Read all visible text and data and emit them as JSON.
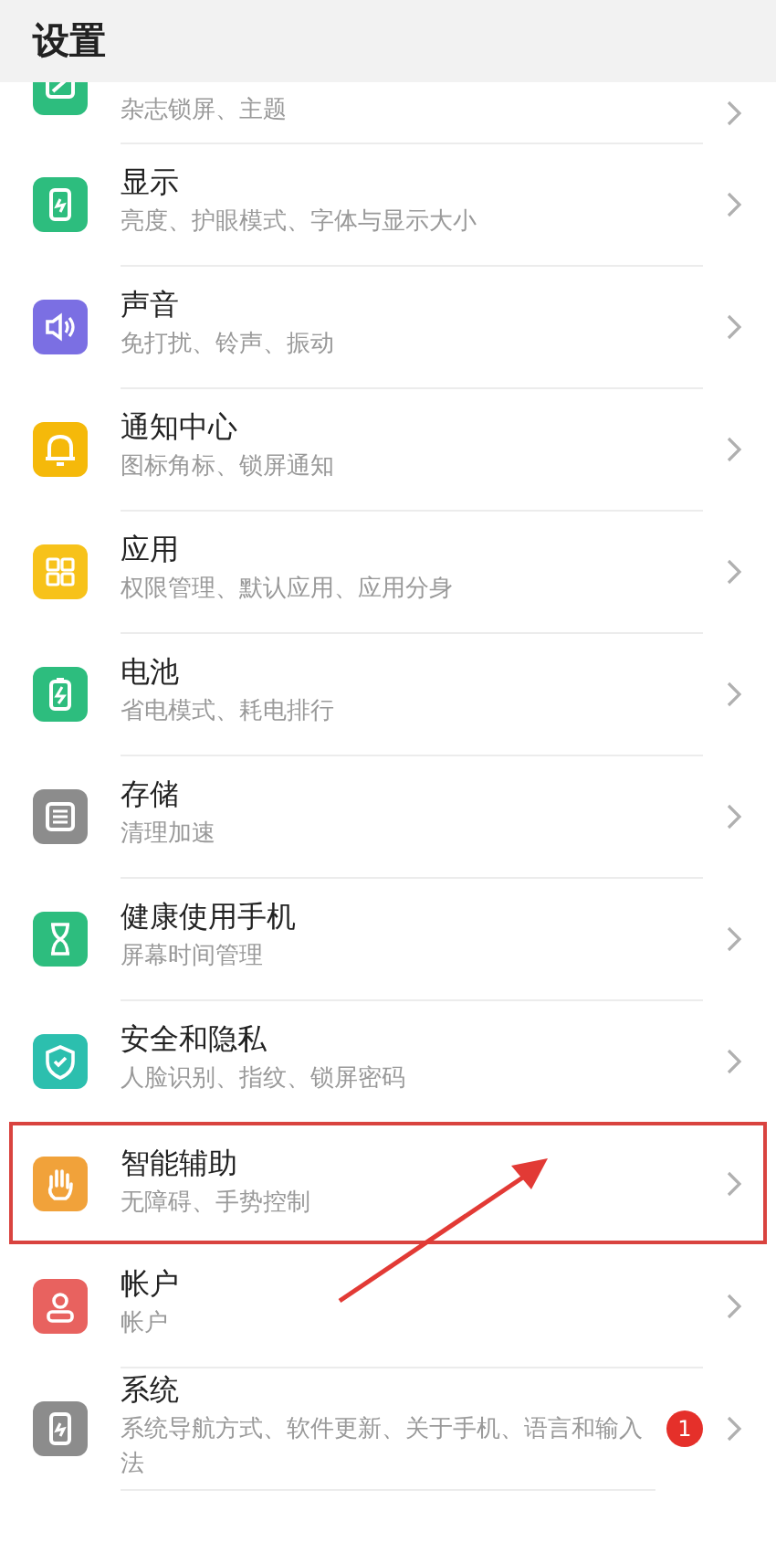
{
  "header": {
    "title": "设置"
  },
  "items": [
    {
      "subtitle": "杂志锁屏、主题",
      "color": "#2dbd7e",
      "selected": false
    },
    {
      "title": "显示",
      "subtitle": "亮度、护眼模式、字体与显示大小",
      "color": "#2dbd7e",
      "selected": false
    },
    {
      "title": "声音",
      "subtitle": "免打扰、铃声、振动",
      "color": "#7b6fe3",
      "selected": false
    },
    {
      "title": "通知中心",
      "subtitle": "图标角标、锁屏通知",
      "color": "#f5b90a",
      "selected": false
    },
    {
      "title": "应用",
      "subtitle": "权限管理、默认应用、应用分身",
      "color": "#f7c21a",
      "selected": false
    },
    {
      "title": "电池",
      "subtitle": "省电模式、耗电排行",
      "color": "#2dbd7e",
      "selected": false
    },
    {
      "title": "存储",
      "subtitle": "清理加速",
      "color": "#8c8c8c",
      "selected": false
    },
    {
      "title": "健康使用手机",
      "subtitle": "屏幕时间管理",
      "color": "#2dbd7e",
      "selected": false
    },
    {
      "title": "安全和隐私",
      "subtitle": "人脸识别、指纹、锁屏密码",
      "color": "#2cbfae",
      "selected": false
    },
    {
      "title": "智能辅助",
      "subtitle": "无障碍、手势控制",
      "color": "#f1a23a",
      "selected": true
    },
    {
      "title": "帐户",
      "subtitle": "帐户",
      "color": "#e8625f",
      "selected": false
    },
    {
      "title": "系统",
      "subtitle": "系统导航方式、软件更新、关于手机、语言和输入法",
      "color": "#8c8c8c",
      "selected": false,
      "badge": "1"
    }
  ]
}
